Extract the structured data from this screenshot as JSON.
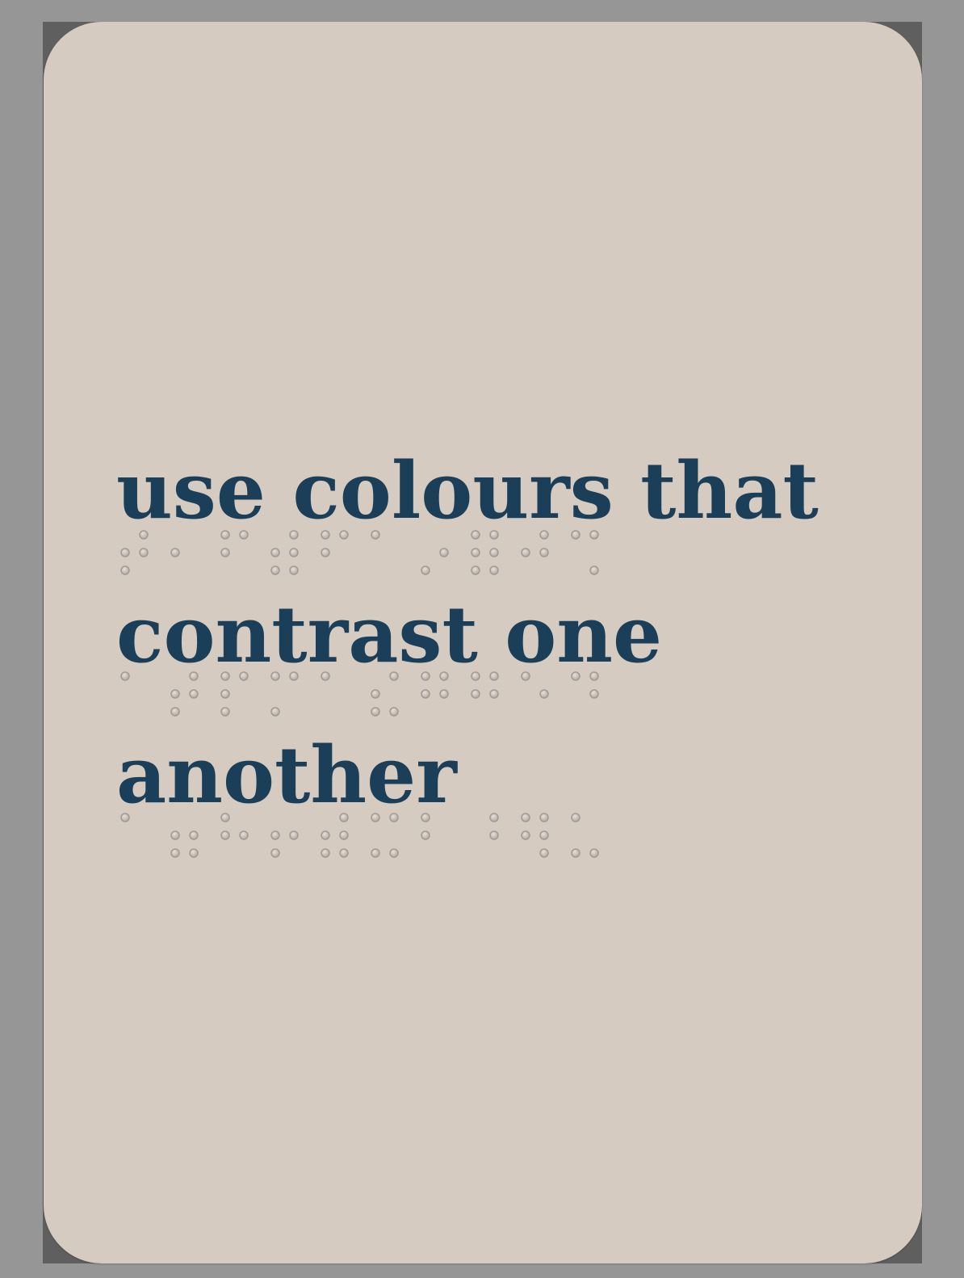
{
  "card": {
    "lines": [
      "use colours that",
      "contrast one",
      "another"
    ]
  },
  "colors": {
    "background": "#969696",
    "frame": "#5f5f5f",
    "card": "#d6cbc1",
    "text": "#1b3f59",
    "braille_dot": "#b3aba3"
  },
  "braille_rows": [
    [
      [
        0,
        1,
        1,
        1,
        1,
        0
      ],
      [
        0,
        1,
        0,
        0,
        0,
        0
      ],
      [
        1,
        1,
        0,
        1,
        0,
        0
      ],
      [
        0,
        1,
        1,
        1,
        1,
        1
      ],
      [
        1,
        1,
        0,
        1,
        0,
        0
      ],
      [
        1,
        0,
        0,
        0,
        0,
        0
      ],
      [
        0,
        0,
        1,
        0,
        1,
        0
      ],
      [
        1,
        1,
        1,
        1,
        1,
        1
      ],
      [
        0,
        1,
        0,
        1,
        1,
        0
      ],
      [
        1,
        0,
        0,
        1,
        0,
        1
      ]
    ],
    [
      [
        1,
        0,
        0,
        0,
        0,
        0
      ],
      [
        0,
        1,
        1,
        1,
        1,
        0
      ],
      [
        1,
        1,
        1,
        1,
        0,
        0
      ],
      [
        1,
        0,
        1,
        1,
        0,
        0
      ],
      [
        1,
        0,
        0,
        0,
        0,
        0
      ],
      [
        0,
        1,
        1,
        1,
        0,
        1
      ],
      [
        1,
        1,
        0,
        1,
        1,
        0
      ],
      [
        1,
        1,
        0,
        1,
        1,
        0
      ],
      [
        1,
        0,
        0,
        0,
        1,
        0
      ],
      [
        1,
        0,
        0,
        1,
        1,
        0
      ]
    ],
    [
      [
        1,
        0,
        0,
        0,
        0,
        0
      ],
      [
        0,
        1,
        1,
        0,
        1,
        1
      ],
      [
        1,
        1,
        0,
        0,
        1,
        0
      ],
      [
        0,
        1,
        1,
        0,
        1,
        0
      ],
      [
        0,
        1,
        1,
        1,
        1,
        1
      ],
      [
        1,
        0,
        1,
        1,
        0,
        1
      ],
      [
        1,
        1,
        0,
        0,
        0,
        0
      ],
      [
        0,
        0,
        0,
        1,
        1,
        0
      ],
      [
        1,
        1,
        0,
        1,
        1,
        1
      ],
      [
        1,
        0,
        1,
        0,
        0,
        1
      ]
    ]
  ]
}
